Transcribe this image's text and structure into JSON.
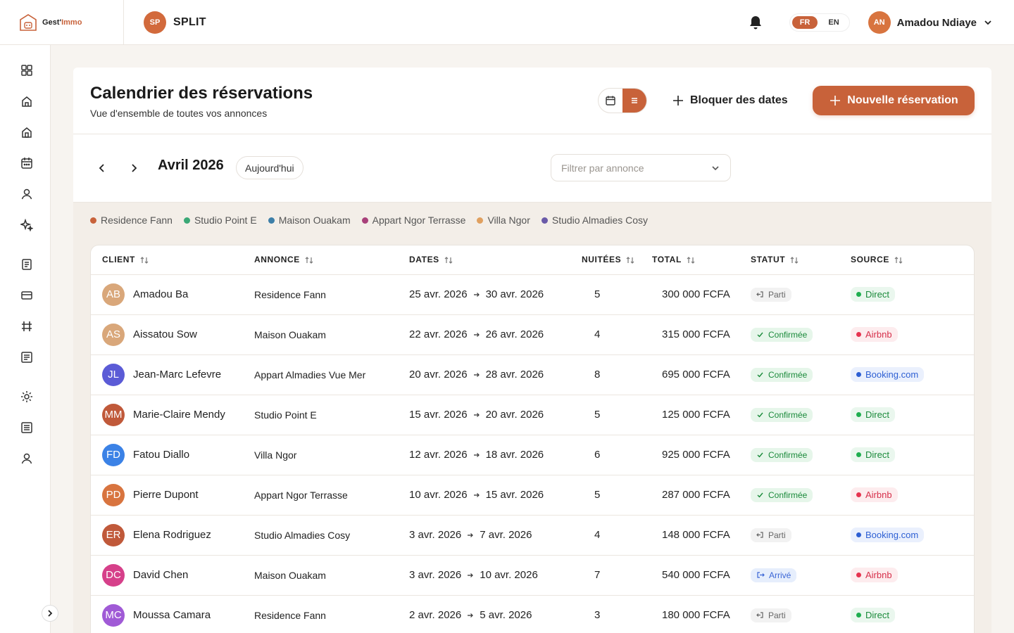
{
  "app": {
    "logo_text_main": "Gest",
    "logo_text_accent": "Immo",
    "org_initials": "SP",
    "org_name": "SPLIT"
  },
  "header": {
    "languages": [
      {
        "code": "FR",
        "active": true
      },
      {
        "code": "EN",
        "active": false
      }
    ],
    "user_initials": "AN",
    "user_name": "Amadou Ndiaye"
  },
  "sidebar": {
    "icons": [
      "dashboard-icon",
      "home-icon",
      "property-icon",
      "calendar-icon",
      "user-icon",
      "sparkle-icon",
      "document-icon",
      "card-icon",
      "hashtag-icon",
      "list-icon",
      "settings-icon",
      "report-icon",
      "profile-icon"
    ]
  },
  "page": {
    "title": "Calendrier des réservations",
    "subtitle": "Vue d'ensemble de toutes vos annonces",
    "block_dates": "Bloquer des dates",
    "new_reservation": "Nouvelle réservation",
    "month": "Avril 2026",
    "today": "Aujourd'hui",
    "filter_placeholder": "Filtrer par annonce"
  },
  "legend": [
    {
      "label": "Residence Fann",
      "color": "#c8623a"
    },
    {
      "label": "Studio Point E",
      "color": "#3aa876"
    },
    {
      "label": "Maison Ouakam",
      "color": "#3d7fa8"
    },
    {
      "label": "Appart Ngor Terrasse",
      "color": "#a8407a"
    },
    {
      "label": "Villa Ngor",
      "color": "#e0a060"
    },
    {
      "label": "Studio Almadies Cosy",
      "color": "#6a5aa8"
    }
  ],
  "table": {
    "headers": [
      "CLIENT",
      "ANNONCE",
      "DATES",
      "NUITÉES",
      "TOTAL",
      "STATUT",
      "SOURCE"
    ],
    "rows": [
      {
        "initials": "AB",
        "avatar_color": "#d9a77a",
        "client": "Amadou Ba",
        "annonce": "Residence Fann",
        "start": "25 avr. 2026",
        "end": "30 avr. 2026",
        "nuits": "5",
        "total": "300 000 FCFA",
        "statut": "Parti",
        "statut_type": "parti",
        "source": "Direct",
        "source_type": "direct"
      },
      {
        "initials": "AS",
        "avatar_color": "#d9a77a",
        "client": "Aissatou Sow",
        "annonce": "Maison Ouakam",
        "start": "22 avr. 2026",
        "end": "26 avr. 2026",
        "nuits": "4",
        "total": "315 000 FCFA",
        "statut": "Confirmée",
        "statut_type": "confirm",
        "source": "Airbnb",
        "source_type": "airbnb"
      },
      {
        "initials": "JL",
        "avatar_color": "#5b5bd6",
        "client": "Jean-Marc Lefevre",
        "annonce": "Appart Almadies Vue Mer",
        "start": "20 avr. 2026",
        "end": "28 avr. 2026",
        "nuits": "8",
        "total": "695 000 FCFA",
        "statut": "Confirmée",
        "statut_type": "confirm",
        "source": "Booking.com",
        "source_type": "booking"
      },
      {
        "initials": "MM",
        "avatar_color": "#c0593a",
        "client": "Marie-Claire Mendy",
        "annonce": "Studio Point E",
        "start": "15 avr. 2026",
        "end": "20 avr. 2026",
        "nuits": "5",
        "total": "125 000 FCFA",
        "statut": "Confirmée",
        "statut_type": "confirm",
        "source": "Direct",
        "source_type": "direct"
      },
      {
        "initials": "FD",
        "avatar_color": "#3b82e6",
        "client": "Fatou Diallo",
        "annonce": "Villa Ngor",
        "start": "12 avr. 2026",
        "end": "18 avr. 2026",
        "nuits": "6",
        "total": "925 000 FCFA",
        "statut": "Confirmée",
        "statut_type": "confirm",
        "source": "Direct",
        "source_type": "direct"
      },
      {
        "initials": "PD",
        "avatar_color": "#d8743f",
        "client": "Pierre Dupont",
        "annonce": "Appart Ngor Terrasse",
        "start": "10 avr. 2026",
        "end": "15 avr. 2026",
        "nuits": "5",
        "total": "287 000 FCFA",
        "statut": "Confirmée",
        "statut_type": "confirm",
        "source": "Airbnb",
        "source_type": "airbnb"
      },
      {
        "initials": "ER",
        "avatar_color": "#c0593a",
        "client": "Elena Rodriguez",
        "annonce": "Studio Almadies Cosy",
        "start": "3 avr. 2026",
        "end": "7 avr. 2026",
        "nuits": "4",
        "total": "148 000 FCFA",
        "statut": "Parti",
        "statut_type": "parti",
        "source": "Booking.com",
        "source_type": "booking"
      },
      {
        "initials": "DC",
        "avatar_color": "#d6408a",
        "client": "David Chen",
        "annonce": "Maison Ouakam",
        "start": "3 avr. 2026",
        "end": "10 avr. 2026",
        "nuits": "7",
        "total": "540 000 FCFA",
        "statut": "Arrivé",
        "statut_type": "arrive",
        "source": "Airbnb",
        "source_type": "airbnb"
      },
      {
        "initials": "MC",
        "avatar_color": "#a05ad6",
        "client": "Moussa Camara",
        "annonce": "Residence Fann",
        "start": "2 avr. 2026",
        "end": "5 avr. 2026",
        "nuits": "3",
        "total": "180 000 FCFA",
        "statut": "Parti",
        "statut_type": "parti",
        "source": "Direct",
        "source_type": "direct"
      }
    ]
  }
}
